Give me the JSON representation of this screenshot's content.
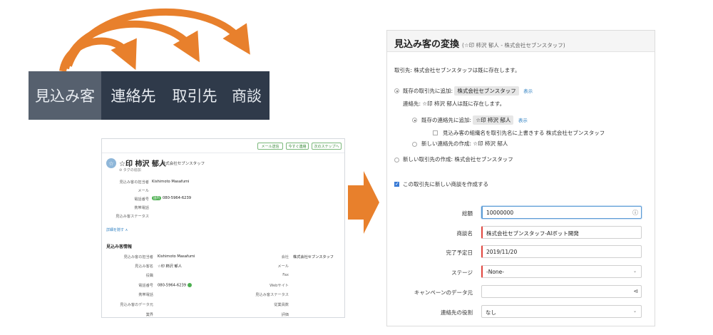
{
  "colors": {
    "orange": "#e8802c",
    "tabbar": "#2f3a4a",
    "tab_active": "#56606e",
    "link": "#2d7fc1",
    "required": "#e0453e"
  },
  "tabs": [
    {
      "label": "見込み客",
      "active": true
    },
    {
      "label": "連絡先",
      "active": false
    },
    {
      "label": "取引先",
      "active": false
    },
    {
      "label": "商談",
      "active": false
    }
  ],
  "record": {
    "buttons": [
      "メール送信",
      "今すぐ連絡",
      "次のステップへ"
    ],
    "name": "☆印 柿沢 郁人",
    "company": "- 株式会社セブンスタッフ",
    "tag_add": "タグの追加",
    "fields": [
      {
        "label": "見込み客の担当者",
        "value": "Kishimoto Masafumi"
      },
      {
        "label": "メール",
        "value": ""
      },
      {
        "label": "電話番号",
        "badge": "国内",
        "value": "080-5964-6239"
      },
      {
        "label": "携帯電話",
        "value": ""
      },
      {
        "label": "見込み客ステータス",
        "value": ""
      }
    ],
    "more_link": "詳細を隠す ∧",
    "section_title": "見込み客情報",
    "info_left": [
      {
        "label": "見込み客の担当者",
        "value": "Kishimoto Masafumi"
      },
      {
        "label": "見込み客名",
        "value": "☆印 柿沢 郁人"
      },
      {
        "label": "役職",
        "value": ""
      },
      {
        "label": "電話番号",
        "value": "080-5964-6239"
      },
      {
        "label": "携帯電話",
        "value": ""
      },
      {
        "label": "見込み客のデータ元",
        "value": ""
      },
      {
        "label": "業界",
        "value": ""
      }
    ],
    "info_right": [
      {
        "label": "会社",
        "value": "株式会社セブンスタッフ"
      },
      {
        "label": "メール",
        "value": ""
      },
      {
        "label": "Fax",
        "value": ""
      },
      {
        "label": "Webサイト",
        "value": ""
      },
      {
        "label": "見込み客ステータス",
        "value": ""
      },
      {
        "label": "従業員数",
        "value": ""
      },
      {
        "label": "評価",
        "value": ""
      }
    ]
  },
  "dialog": {
    "title": "見込み客の変換",
    "subtitle": "(☆印 柿沢 郁人 - 株式会社セブンスタッフ)",
    "account_exists": "取引先: 株式会社セブンスタッフは既に存在します。",
    "add_existing_account_label": "既存の取引先に追加:",
    "existing_account": "株式会社セブンスタッフ",
    "show_link": "表示",
    "contact_exists": "連絡先: ☆印 柿沢 郁人は既に存在します。",
    "add_existing_contact_label": "既存の連絡先に追加:",
    "existing_contact": "☆印 柿沢 郁人",
    "overwrite_checkbox": "見込み客の組織名を取引先名に上書きする 株式会社セブンスタッフ",
    "new_contact": "新しい連絡先の作成: ☆印 柿沢 郁人",
    "new_account": "新しい取引先の作成: 株式会社セブンスタッフ",
    "create_deal_checkbox": "この取引先に新しい商談を作成する",
    "form": [
      {
        "label": "総額",
        "value": "10000000",
        "icon": "ⓘ"
      },
      {
        "label": "商談名",
        "value": "株式会社セブンスタッフ-AIボット開発"
      },
      {
        "label": "完了予定日",
        "value": "2019/11/20"
      },
      {
        "label": "ステージ",
        "value": "-None-",
        "caret": "⌄"
      },
      {
        "label": "キャンペーンのデータ元",
        "value": "",
        "icon": "⊲"
      },
      {
        "label": "連絡先の役割",
        "value": "なし",
        "caret": "⌄"
      }
    ]
  }
}
